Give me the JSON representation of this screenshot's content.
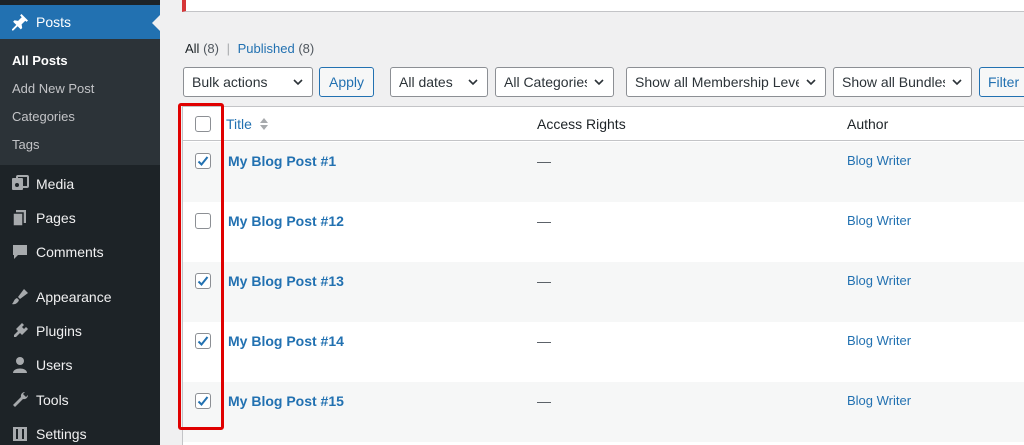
{
  "sidebar": {
    "posts": "Posts",
    "submenu": [
      "All Posts",
      "Add New Post",
      "Categories",
      "Tags"
    ],
    "items": [
      "Media",
      "Pages",
      "Comments",
      "Appearance",
      "Plugins",
      "Users",
      "Tools",
      "Settings"
    ],
    "icons": [
      "pushpin-icon",
      "media-icon",
      "pages-icon",
      "comments-icon",
      "appearance-icon",
      "plugins-icon",
      "users-icon",
      "tools-icon",
      "settings-icon"
    ]
  },
  "filters": {
    "all": "All",
    "all_count": "(8)",
    "separator": "|",
    "published": "Published",
    "published_count": "(8)"
  },
  "toolbar": {
    "bulk_actions": "Bulk actions",
    "apply": "Apply",
    "dates": "All dates",
    "categories": "All Categories",
    "membership": "Show all Membership Levels",
    "bundles": "Show all Bundles",
    "filter": "Filter"
  },
  "table": {
    "columns": [
      "Title",
      "Access Rights",
      "Author"
    ],
    "rows": [
      {
        "title": "My Blog Post #1",
        "access": "—",
        "author": "Blog Writer",
        "checked": true
      },
      {
        "title": "My Blog Post #12",
        "access": "—",
        "author": "Blog Writer",
        "checked": false
      },
      {
        "title": "My Blog Post #13",
        "access": "—",
        "author": "Blog Writer",
        "checked": true
      },
      {
        "title": "My Blog Post #14",
        "access": "—",
        "author": "Blog Writer",
        "checked": true
      },
      {
        "title": "My Blog Post #15",
        "access": "—",
        "author": "Blog Writer",
        "checked": true
      }
    ]
  },
  "colors": {
    "sidebar_bg": "#1d2327",
    "accent": "#2271b1",
    "highlight": "#e00000"
  }
}
